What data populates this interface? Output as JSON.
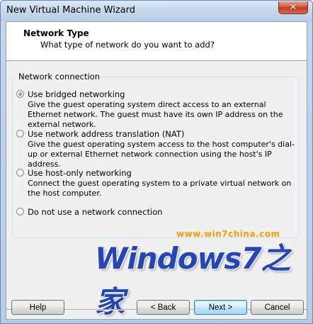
{
  "window": {
    "title": "New Virtual Machine Wizard",
    "close_glyph": "✕"
  },
  "header": {
    "title": "Network Type",
    "subtitle": "What type of network do you want to add?"
  },
  "group": {
    "legend": "Network connection",
    "options": [
      {
        "label": "Use bridged networking",
        "selected": true,
        "description": "Give the guest operating system direct access to an external Ethernet network. The guest must have its own IP address on the external network."
      },
      {
        "label": "Use network address translation (NAT)",
        "selected": false,
        "description": "Give the guest operating system access to the host computer's dial-up or external Ethernet network connection using the host's IP address."
      },
      {
        "label": "Use host-only networking",
        "selected": false,
        "description": "Connect the guest operating system to a private virtual network on the host computer."
      },
      {
        "label": "Do not use a network connection",
        "selected": false,
        "description": ""
      }
    ]
  },
  "watermark": {
    "url": "www.win7china.com",
    "logo": "Windows7之家"
  },
  "buttons": {
    "help": "Help",
    "back": "< Back",
    "next": "Next >",
    "cancel": "Cancel"
  }
}
